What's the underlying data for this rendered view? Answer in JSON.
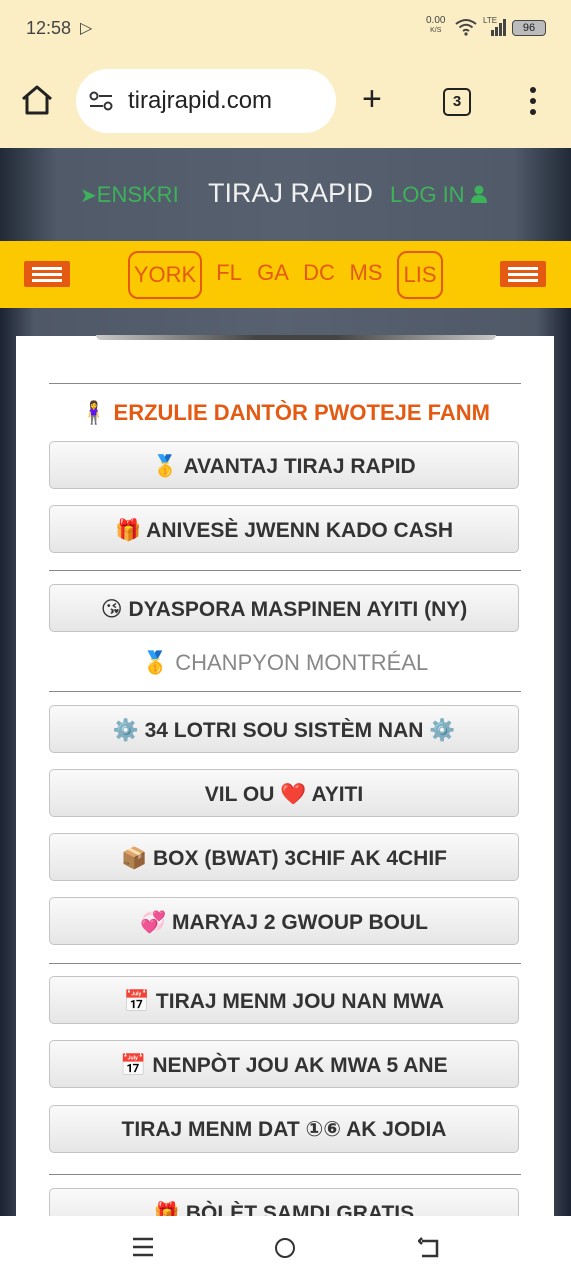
{
  "status_bar": {
    "time": "12:58",
    "net_speed_value": "0.00",
    "net_speed_unit": "K/S",
    "network": "LTE",
    "battery": "96"
  },
  "browser": {
    "url": "tirajrapid.com",
    "tab_count": "3"
  },
  "site_header": {
    "signup": "ENSKRI",
    "title": "TIRAJ RAPID",
    "login": "LOG IN"
  },
  "nav": {
    "items": [
      "YORK",
      "FL",
      "GA",
      "DC",
      "MS",
      "LIS"
    ]
  },
  "content": {
    "heading": "ERZULIE DANTÒR PWOTEJE FANM",
    "heading_icon": "🧍‍♀️",
    "buttons": [
      {
        "icon": "🥇",
        "label": "AVANTAJ TIRAJ RAPID"
      },
      {
        "icon": "🎁",
        "label": "ANIVESÈ JWENN KADO CASH"
      },
      {
        "icon": "😘",
        "label": "DYASPORA MASPINEN AYITI (NY)"
      },
      {
        "icon": "⚙️",
        "label": "34 LOTRI SOU SISTÈM NAN",
        "icon_after": "⚙️"
      },
      {
        "label_before": "VIL OU",
        "icon": "❤️",
        "label": "AYITI"
      },
      {
        "icon": "📦",
        "label": "BOX (BWAT) 3CHIF AK 4CHIF"
      },
      {
        "icon": "💞",
        "label": "MARYAJ 2 GWOUP BOUL"
      },
      {
        "icon": "📅",
        "label": "TIRAJ MENM JOU NAN MWA"
      },
      {
        "icon": "📅",
        "label": "NENPÒT JOU AK MWA 5 ANE"
      },
      {
        "label": "TIRAJ MENM DAT ①⑥ AK JODIA"
      },
      {
        "icon": "🎁",
        "label": "BÒLÈT SAMDI GRATIS"
      }
    ],
    "champion_icon": "🥇",
    "champion_text": "CHANPYON MONTRÉAL"
  },
  "colors": {
    "accent_orange": "#e45a12",
    "nav_yellow": "#fcc800",
    "green_links": "#3cb35a",
    "browser_chrome": "#fbeec4"
  }
}
